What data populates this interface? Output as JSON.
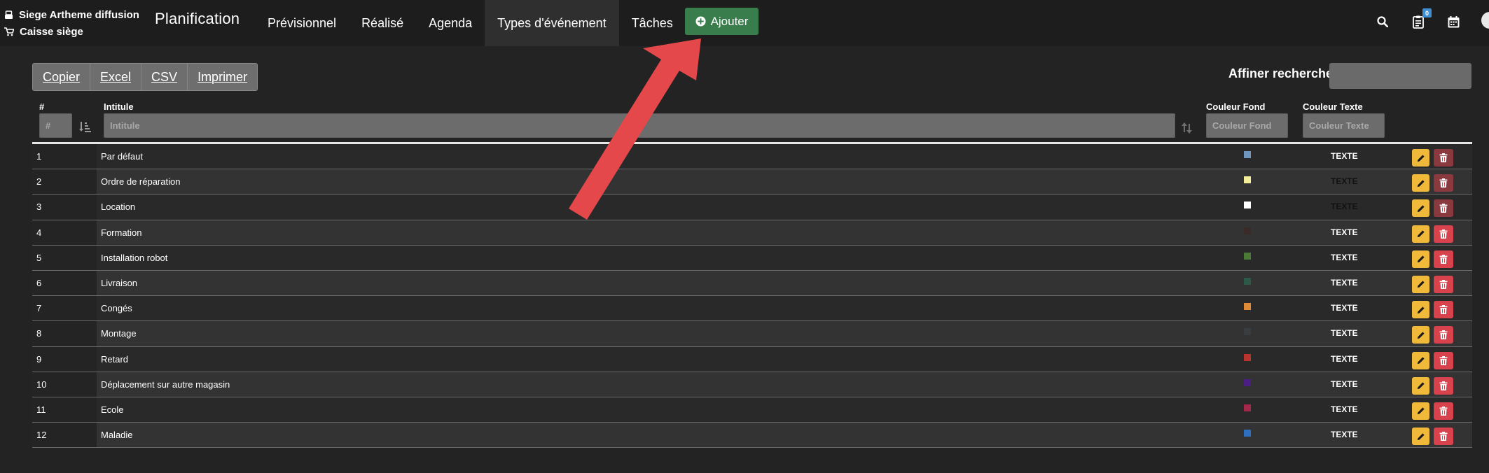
{
  "app": {
    "store_name": "Siege Artheme diffusion",
    "register_name": "Caisse siège",
    "brand": "Planification"
  },
  "nav": {
    "items": [
      {
        "label": "Prévisionnel"
      },
      {
        "label": "Réalisé"
      },
      {
        "label": "Agenda"
      },
      {
        "label": "Types d'événement"
      },
      {
        "label": "Tâches"
      }
    ],
    "active_index": 3,
    "add_button": "Ajouter",
    "notification_count": "0"
  },
  "toolbar": {
    "copy": "Copier",
    "excel": "Excel",
    "csv": "CSV",
    "print": "Imprimer",
    "filter_label": "Affiner recherche",
    "filter_value": ""
  },
  "table": {
    "headers": {
      "num": "#",
      "title": "Intitule",
      "bg_color": "Couleur Fond",
      "text_color": "Couleur Texte"
    },
    "filters": {
      "num_placeholder": "#",
      "title_placeholder": "Intitule",
      "bg_placeholder": "Couleur Fond",
      "text_placeholder": "Couleur Texte"
    },
    "rows": [
      {
        "num": "1",
        "label": "Par défaut",
        "bg": "#6f97bd",
        "text_label": "TEXTE",
        "text_color": "#ffffff",
        "delete_muted": true
      },
      {
        "num": "2",
        "label": "Ordre de réparation",
        "bg": "#f4ef9a",
        "text_label": "TEXTE",
        "text_color": "#111111",
        "delete_muted": true
      },
      {
        "num": "3",
        "label": "Location",
        "bg": "#ffffff",
        "text_label": "TEXTE",
        "text_color": "#111111",
        "delete_muted": true
      },
      {
        "num": "4",
        "label": "Formation",
        "bg": "#3a2a28",
        "text_label": "TEXTE",
        "text_color": "#ffffff",
        "delete_muted": false
      },
      {
        "num": "5",
        "label": "Installation robot",
        "bg": "#4a7a36",
        "text_label": "TEXTE",
        "text_color": "#ffffff",
        "delete_muted": false
      },
      {
        "num": "6",
        "label": "Livraison",
        "bg": "#2d5a48",
        "text_label": "TEXTE",
        "text_color": "#ffffff",
        "delete_muted": false
      },
      {
        "num": "7",
        "label": "Congés",
        "bg": "#e08a38",
        "text_label": "TEXTE",
        "text_color": "#ffffff",
        "delete_muted": false
      },
      {
        "num": "8",
        "label": "Montage",
        "bg": "#3a3d40",
        "text_label": "TEXTE",
        "text_color": "#ffffff",
        "delete_muted": false
      },
      {
        "num": "9",
        "label": "Retard",
        "bg": "#b7352d",
        "text_label": "TEXTE",
        "text_color": "#ffffff",
        "delete_muted": false
      },
      {
        "num": "10",
        "label": "Déplacement sur autre magasin",
        "bg": "#4a1e84",
        "text_label": "TEXTE",
        "text_color": "#ffffff",
        "delete_muted": false
      },
      {
        "num": "11",
        "label": "Ecole",
        "bg": "#a3284a",
        "text_label": "TEXTE",
        "text_color": "#ffffff",
        "delete_muted": false
      },
      {
        "num": "12",
        "label": "Maladie",
        "bg": "#2f6fc0",
        "text_label": "TEXTE",
        "text_color": "#ffffff",
        "delete_muted": false
      }
    ]
  },
  "colors": {
    "add_button": "#3a7d4c",
    "edit_button": "#f0b93a",
    "delete_button": "#d7424c",
    "annotation_arrow": "#e5484a"
  },
  "icons": {
    "store": "register-icon",
    "register": "cart-icon",
    "add": "plus-circle-icon",
    "search": "search-icon",
    "notifications": "clipboard-icon",
    "calendar": "calendar-icon",
    "edit": "pencil-icon",
    "delete": "trash-icon",
    "sort": "sort-icon"
  }
}
